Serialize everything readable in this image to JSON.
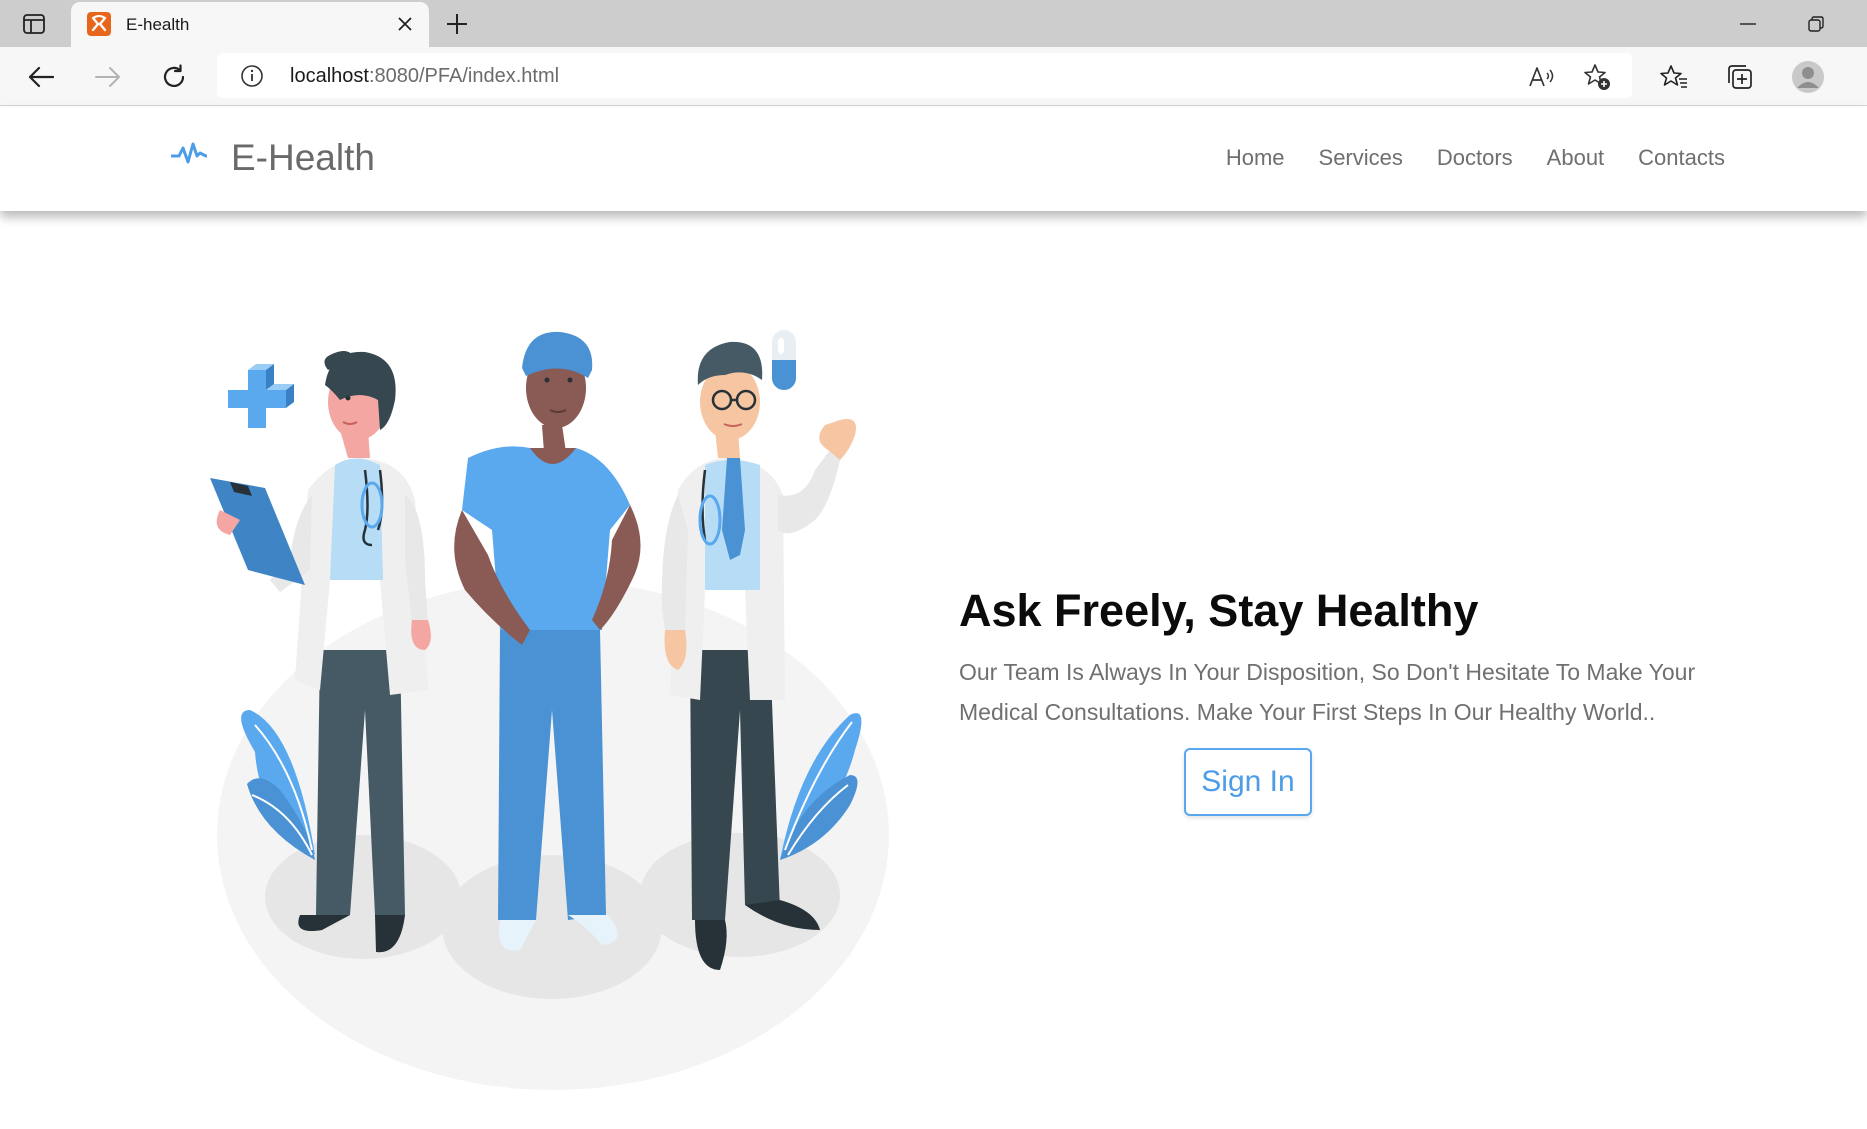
{
  "browser": {
    "tab_title": "E-health",
    "url_host": "localhost",
    "url_rest": ":8080/PFA/index.html"
  },
  "site": {
    "logo_text": "E-Health",
    "nav": [
      "Home",
      "Services",
      "Doctors",
      "About",
      "Contacts"
    ]
  },
  "hero": {
    "title": "Ask Freely, Stay Healthy",
    "text": "Our Team Is Always In Your Disposition, So Don't Hesitate To Make Your Medical Consultations. Make Your First Steps In Our Healthy World..",
    "button_label": "Sign In"
  },
  "colors": {
    "accent": "#4c9ce8",
    "brand_favicon": "#e8661c",
    "illustration_blue": "#4a92d4",
    "text_gray": "#707070"
  },
  "icons": [
    "sidebar-icon",
    "xampp-favicon",
    "close-icon",
    "plus-icon",
    "minimize-icon",
    "restore-icon",
    "back-icon",
    "forward-icon",
    "refresh-icon",
    "info-icon",
    "read-aloud-icon",
    "add-favorite-icon",
    "favorites-icon",
    "collections-icon",
    "profile-icon",
    "pulse-icon"
  ]
}
